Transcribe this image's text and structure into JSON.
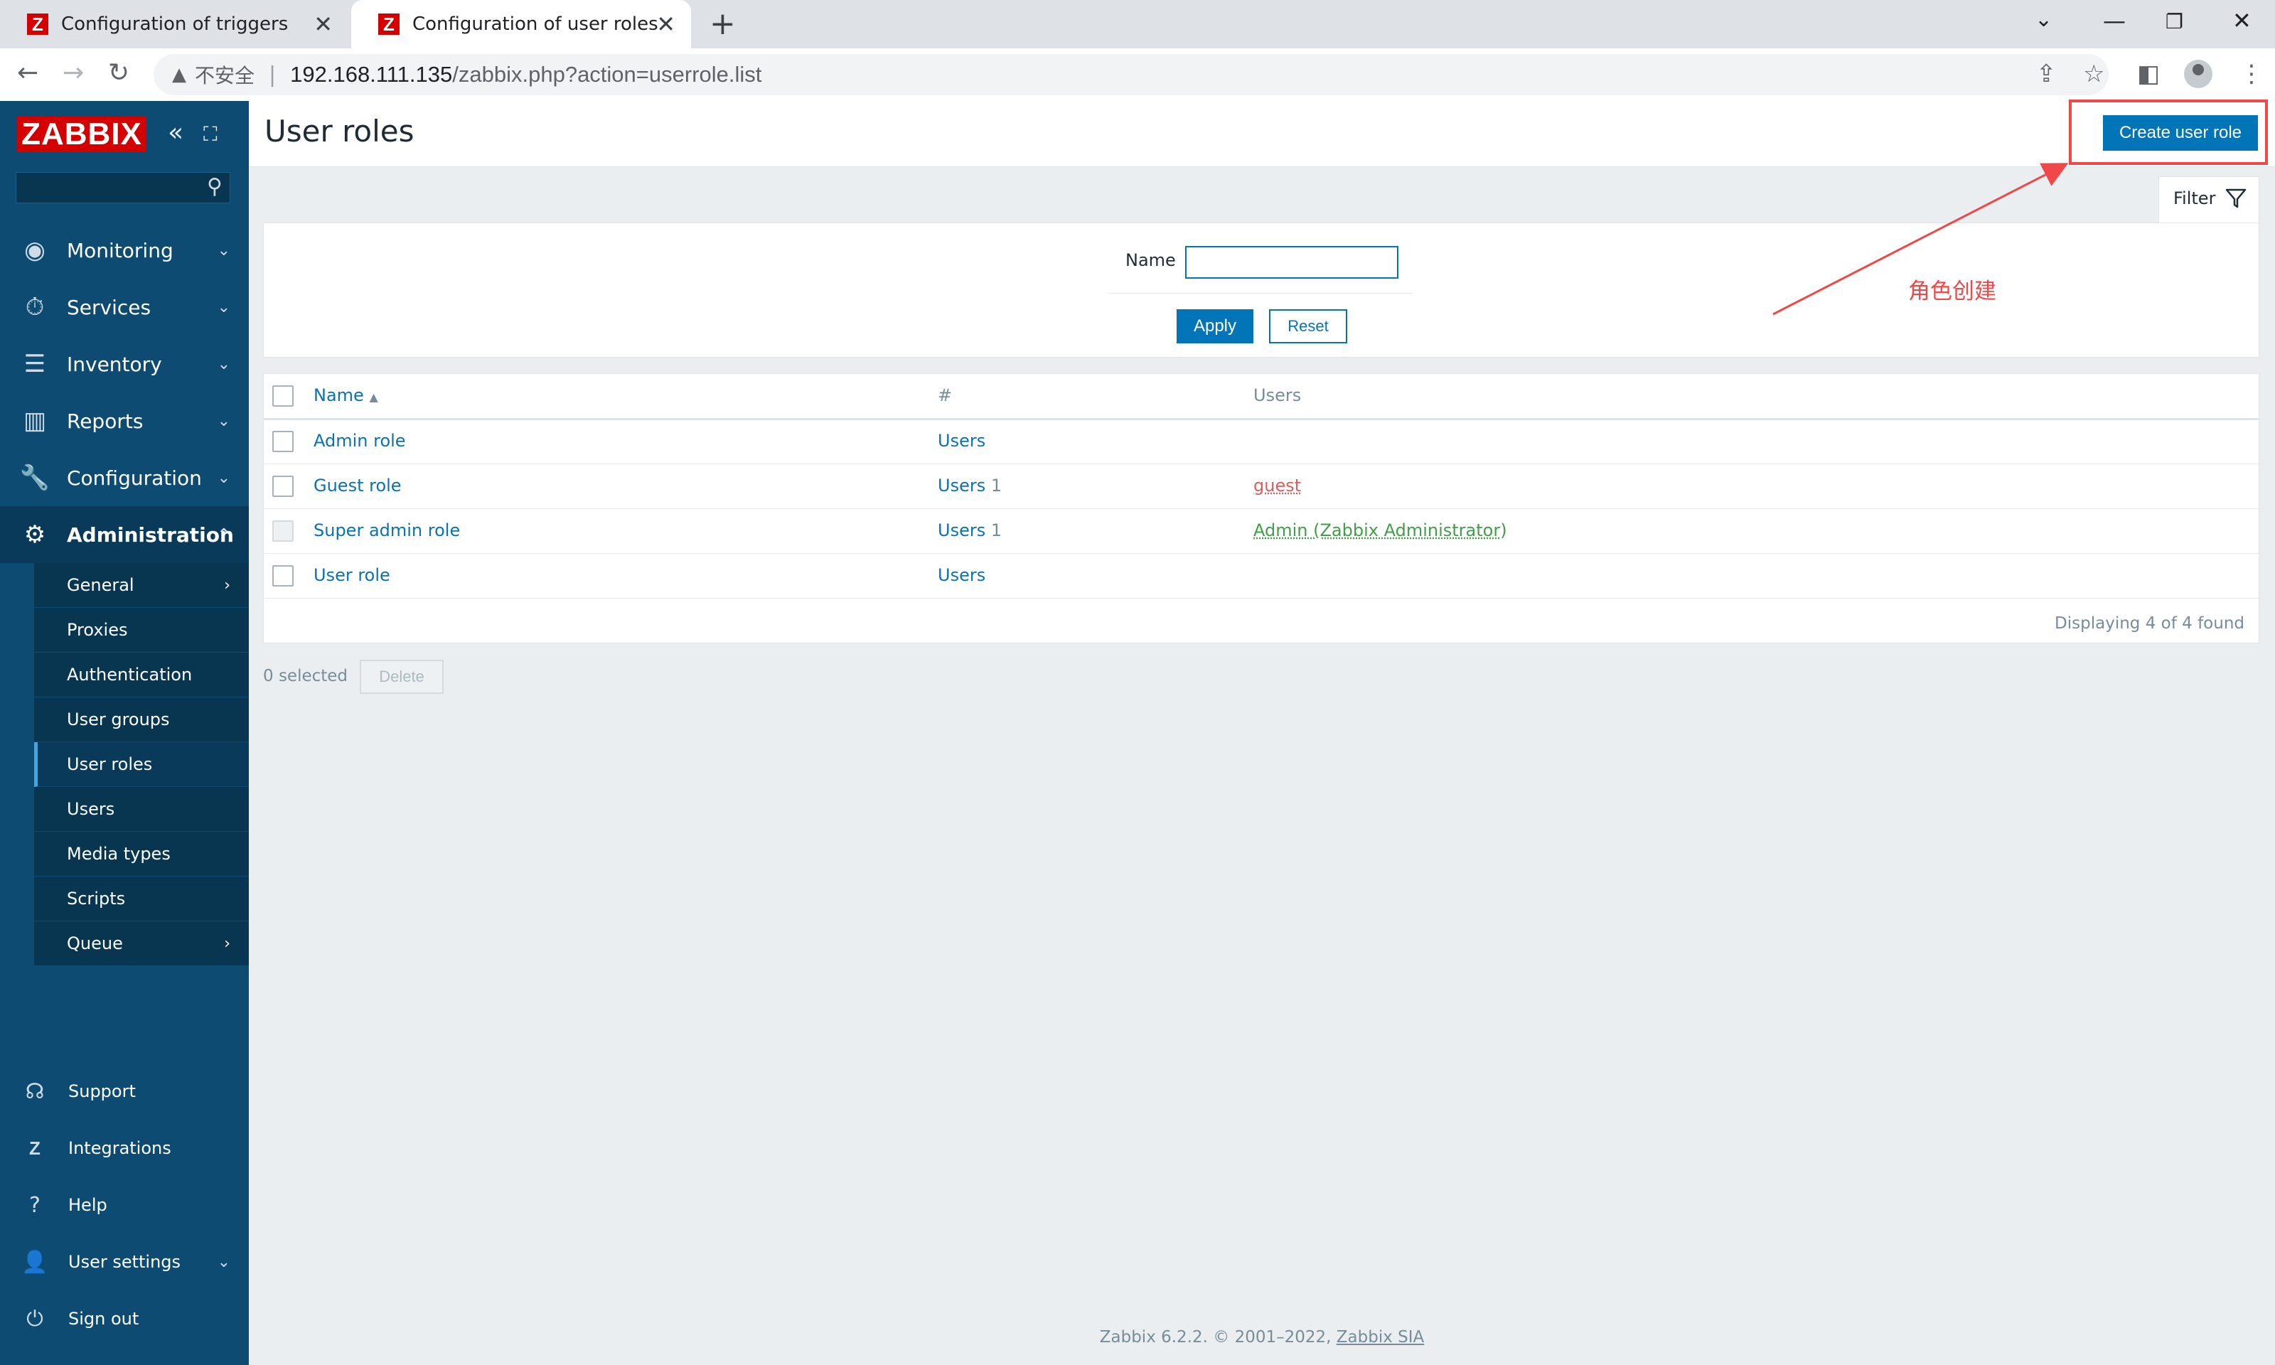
{
  "browser": {
    "tabs": [
      {
        "title": "Configuration of triggers"
      },
      {
        "title": "Configuration of user roles"
      }
    ],
    "favicon_letter": "Z",
    "address": {
      "security_label": "不安全",
      "host": "192.168.111.135",
      "path": "/zabbix.php?action=userrole.list"
    }
  },
  "sidebar": {
    "logo": "ZABBIX",
    "menu": [
      {
        "label": "Monitoring"
      },
      {
        "label": "Services"
      },
      {
        "label": "Inventory"
      },
      {
        "label": "Reports"
      },
      {
        "label": "Configuration"
      },
      {
        "label": "Administration"
      }
    ],
    "submenu": [
      {
        "label": "General"
      },
      {
        "label": "Proxies"
      },
      {
        "label": "Authentication"
      },
      {
        "label": "User groups"
      },
      {
        "label": "User roles"
      },
      {
        "label": "Users"
      },
      {
        "label": "Media types"
      },
      {
        "label": "Scripts"
      },
      {
        "label": "Queue"
      }
    ],
    "footer": [
      {
        "label": "Support"
      },
      {
        "label": "Integrations"
      },
      {
        "label": "Help"
      },
      {
        "label": "User settings"
      },
      {
        "label": "Sign out"
      }
    ]
  },
  "page": {
    "title": "User roles",
    "create_button": "Create user role",
    "filter_tab": "Filter",
    "filter": {
      "name_label": "Name",
      "name_value": "",
      "apply": "Apply",
      "reset": "Reset"
    },
    "table": {
      "headers": {
        "name": "Name",
        "count": "#",
        "users": "Users"
      },
      "rows": [
        {
          "name": "Admin role",
          "users_link": "Users",
          "count": "",
          "users": ""
        },
        {
          "name": "Guest role",
          "users_link": "Users",
          "count": "1",
          "users": "guest"
        },
        {
          "name": "Super admin role",
          "users_link": "Users",
          "count": "1",
          "users": "Admin (Zabbix Administrator)"
        },
        {
          "name": "User role",
          "users_link": "Users",
          "count": "",
          "users": ""
        }
      ],
      "displaying": "Displaying 4 of 4 found"
    },
    "selected": "0 selected",
    "delete": "Delete",
    "footer": {
      "text": "Zabbix 6.2.2. © 2001–2022, ",
      "company": "Zabbix SIA"
    }
  },
  "annotation": {
    "text": "角色创建",
    "color": "#f04848"
  },
  "colors": {
    "sidebar": "#0e4b73",
    "accent": "#0275b8",
    "logo": "#d40000"
  }
}
